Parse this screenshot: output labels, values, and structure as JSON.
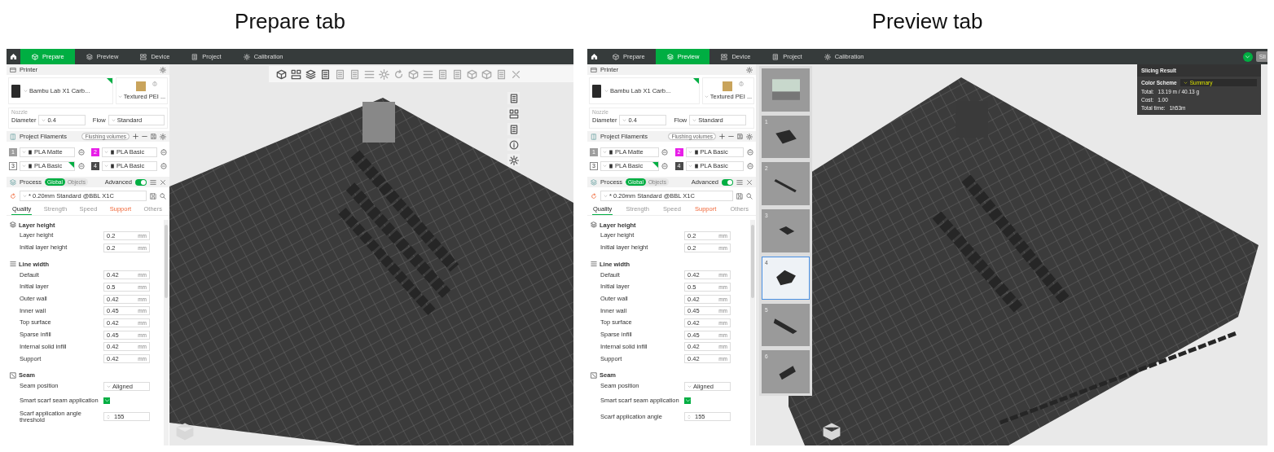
{
  "figures": [
    {
      "caption": "Prepare tab",
      "app": {
        "kind": "prepare",
        "tabs": [
          {
            "label": "Prepare",
            "selected": true
          },
          {
            "label": "Preview",
            "selected": false
          },
          {
            "label": "Device",
            "selected": false
          },
          {
            "label": "Project",
            "selected": false
          },
          {
            "label": "Calibration",
            "selected": false
          }
        ],
        "sidebar": {
          "printer": {
            "title": "Printer",
            "name": "Bambu Lab X1 Carb...",
            "modified": true,
            "plate": "Textured PEI ...",
            "nozzle_label": "Nozzle",
            "diameter_label": "Diameter",
            "diameter": "0.4",
            "flow_label": "Flow",
            "flow": "Standard"
          },
          "filaments": {
            "title": "Project Filaments",
            "flushing_button": "Flushing volumes",
            "items": [
              {
                "number": "1",
                "color": "#9e9e9e",
                "name": "PLA Matte",
                "modified": false
              },
              {
                "number": "2",
                "color": "#e81ee8",
                "name": "PLA Basic",
                "modified": false
              },
              {
                "number": "3",
                "color": "#ffffff",
                "name": "PLA Basic",
                "modified": true
              },
              {
                "number": "4",
                "color": "#4a4a4a",
                "name": "PLA Basic",
                "modified": false
              }
            ]
          },
          "process": {
            "title": "Process",
            "scopes": [
              {
                "label": "Global",
                "selected": true
              },
              {
                "label": "Objects",
                "selected": false
              }
            ],
            "advanced_label": "Advanced",
            "advanced": true,
            "preset": "* 0.20mm Standard @BBL X1C",
            "tabs": [
              {
                "label": "Quality",
                "selected": true,
                "modified": false
              },
              {
                "label": "Strength",
                "selected": false,
                "modified": false
              },
              {
                "label": "Speed",
                "selected": false,
                "modified": false
              },
              {
                "label": "Support",
                "selected": false,
                "modified": true
              },
              {
                "label": "Others",
                "selected": false,
                "modified": false
              }
            ]
          },
          "groups": [
            {
              "title": "Layer height",
              "rows": [
                {
                  "kind": "number",
                  "label": "Layer height",
                  "value": "0.2",
                  "unit": "mm"
                },
                {
                  "kind": "number",
                  "label": "Initial layer height",
                  "value": "0.2",
                  "unit": "mm"
                }
              ]
            },
            {
              "title": "Line width",
              "rows": [
                {
                  "kind": "number",
                  "label": "Default",
                  "value": "0.42",
                  "unit": "mm"
                },
                {
                  "kind": "number",
                  "label": "Initial layer",
                  "value": "0.5",
                  "unit": "mm"
                },
                {
                  "kind": "number",
                  "label": "Outer wall",
                  "value": "0.42",
                  "unit": "mm"
                },
                {
                  "kind": "number",
                  "label": "Inner wall",
                  "value": "0.45",
                  "unit": "mm"
                },
                {
                  "kind": "number",
                  "label": "Top surface",
                  "value": "0.42",
                  "unit": "mm"
                },
                {
                  "kind": "number",
                  "label": "Sparse infill",
                  "value": "0.45",
                  "unit": "mm"
                },
                {
                  "kind": "number",
                  "label": "Internal solid infill",
                  "value": "0.42",
                  "unit": "mm"
                },
                {
                  "kind": "number",
                  "label": "Support",
                  "value": "0.42",
                  "unit": "mm"
                }
              ]
            },
            {
              "title": "Seam",
              "rows": [
                {
                  "kind": "dropdown",
                  "label": "Seam position",
                  "value": "Aligned"
                },
                {
                  "kind": "checkbox",
                  "label": "Smart scarf seam application",
                  "checked": true
                },
                {
                  "kind": "spinner",
                  "label": "Scarf application angle threshold",
                  "value": "155"
                }
              ]
            }
          ]
        }
      }
    },
    {
      "caption": "Preview tab",
      "app": {
        "kind": "preview",
        "tabs": [
          {
            "label": "Prepare",
            "selected": false
          },
          {
            "label": "Preview",
            "selected": true
          },
          {
            "label": "Device",
            "selected": false
          },
          {
            "label": "Project",
            "selected": false
          },
          {
            "label": "Calibration",
            "selected": false
          }
        ],
        "slice_button": "Sli",
        "sidebar": {
          "printer": {
            "title": "Printer",
            "name": "Bambu Lab X1 Carb...",
            "modified": true,
            "plate": "Textured PEI ...",
            "nozzle_label": "Nozzle",
            "diameter_label": "Diameter",
            "diameter": "0.4",
            "flow_label": "Flow",
            "flow": "Standard"
          },
          "filaments": {
            "title": "Project Filaments",
            "flushing_button": "Flushing volumes",
            "items": [
              {
                "number": "1",
                "color": "#9e9e9e",
                "name": "PLA Matte",
                "modified": false
              },
              {
                "number": "2",
                "color": "#e81ee8",
                "name": "PLA Basic",
                "modified": false
              },
              {
                "number": "3",
                "color": "#ffffff",
                "name": "PLA Basic",
                "modified": true
              },
              {
                "number": "4",
                "color": "#4a4a4a",
                "name": "PLA Basic",
                "modified": false
              }
            ]
          },
          "process": {
            "title": "Process",
            "scopes": [
              {
                "label": "Global",
                "selected": true
              },
              {
                "label": "Objects",
                "selected": false
              }
            ],
            "advanced_label": "Advanced",
            "advanced": true,
            "preset": "* 0.20mm Standard @BBL X1C",
            "tabs": [
              {
                "label": "Quality",
                "selected": true,
                "modified": false
              },
              {
                "label": "Strength",
                "selected": false,
                "modified": false
              },
              {
                "label": "Speed",
                "selected": false,
                "modified": false
              },
              {
                "label": "Support",
                "selected": false,
                "modified": true
              },
              {
                "label": "Others",
                "selected": false,
                "modified": false
              }
            ]
          },
          "groups": [
            {
              "title": "Layer height",
              "rows": [
                {
                  "kind": "number",
                  "label": "Layer height",
                  "value": "0.2",
                  "unit": "mm"
                },
                {
                  "kind": "number",
                  "label": "Initial layer height",
                  "value": "0.2",
                  "unit": "mm"
                }
              ]
            },
            {
              "title": "Line width",
              "rows": [
                {
                  "kind": "number",
                  "label": "Default",
                  "value": "0.42",
                  "unit": "mm"
                },
                {
                  "kind": "number",
                  "label": "Initial layer",
                  "value": "0.5",
                  "unit": "mm"
                },
                {
                  "kind": "number",
                  "label": "Outer wall",
                  "value": "0.42",
                  "unit": "mm"
                },
                {
                  "kind": "number",
                  "label": "Inner wall",
                  "value": "0.45",
                  "unit": "mm"
                },
                {
                  "kind": "number",
                  "label": "Top surface",
                  "value": "0.42",
                  "unit": "mm"
                },
                {
                  "kind": "number",
                  "label": "Sparse infill",
                  "value": "0.45",
                  "unit": "mm"
                },
                {
                  "kind": "number",
                  "label": "Internal solid infill",
                  "value": "0.42",
                  "unit": "mm"
                },
                {
                  "kind": "number",
                  "label": "Support",
                  "value": "0.42",
                  "unit": "mm"
                }
              ]
            },
            {
              "title": "Seam",
              "rows": [
                {
                  "kind": "dropdown",
                  "label": "Seam position",
                  "value": "Aligned"
                },
                {
                  "kind": "checkbox",
                  "label": "Smart scarf seam application",
                  "checked": true
                },
                {
                  "kind": "spinner",
                  "label": "Scarf application angle",
                  "value": "155"
                }
              ]
            }
          ]
        },
        "plates": [
          {
            "selected": false
          },
          {
            "number": "1",
            "selected": false
          },
          {
            "number": "2",
            "selected": false
          },
          {
            "number": "3",
            "selected": false
          },
          {
            "number": "4",
            "selected": true
          },
          {
            "number": "5",
            "selected": false
          },
          {
            "number": "6",
            "selected": false
          }
        ],
        "slicing_result": {
          "title": "Slicing Result",
          "scheme_label": "Color Scheme",
          "scheme": "Summary",
          "stats": [
            {
              "label": "Total:",
              "value": "13.19 m / 40.13 g"
            },
            {
              "label": "Cost:",
              "value": "1.00"
            },
            {
              "label": "Total time:",
              "value": "1h53m"
            }
          ]
        }
      }
    }
  ]
}
